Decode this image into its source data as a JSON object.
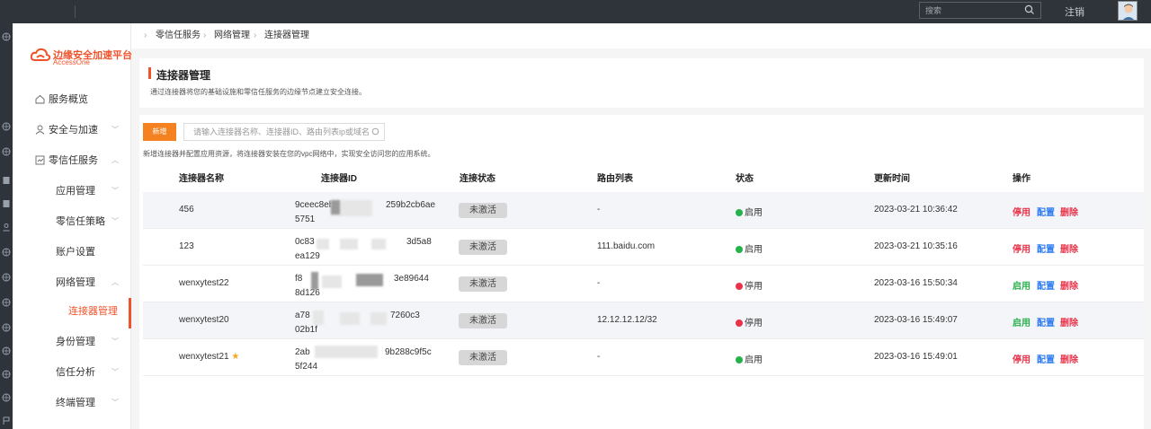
{
  "topbar": {
    "search_placeholder": "搜索",
    "logout": "注销"
  },
  "brand": {
    "title": "边缘安全加速平台",
    "subtitle": "AccessOne",
    "color": "#f0532b"
  },
  "sidebar": {
    "items": [
      {
        "label": "服务概览",
        "icon": "home-icon"
      },
      {
        "label": "安全与加速",
        "icon": "user-icon"
      },
      {
        "label": "零信任服务",
        "icon": "zero-trust-icon"
      }
    ],
    "sub_items": [
      {
        "label": "应用管理"
      },
      {
        "label": "零信任策略"
      },
      {
        "label": "账户设置"
      },
      {
        "label": "网络管理"
      },
      {
        "label": "连接器管理"
      },
      {
        "label": "身份管理"
      },
      {
        "label": "信任分析"
      },
      {
        "label": "终端管理"
      }
    ]
  },
  "breadcrumb": [
    "零信任服务",
    "网络管理",
    "连接器管理"
  ],
  "page": {
    "title": "连接器管理",
    "description": "通过连接器将您的基础设施和零信任服务的边缘节点建立安全连接。"
  },
  "toolbar": {
    "new_label": "新增",
    "filter_placeholder": "请输入连接器名称、连接器ID、路由列表ip或域名",
    "tip": "新增连接器并配置应用资源，将连接器安装在您的vpc网络中，实现安全访问您的应用系统。"
  },
  "table": {
    "headers": [
      "连接器名称",
      "连接器ID",
      "连接状态",
      "路由列表",
      "状态",
      "更新时间",
      "操作"
    ],
    "rows": [
      {
        "name": "456",
        "id_line1": "9ceec8eb",
        "id_line1_tail": "259b2cb6ae",
        "id_line2": "5751",
        "conn": "未激活",
        "route": "-",
        "status": "启用",
        "status_color": "#26b24b",
        "time": "2023-03-21 10:36:42",
        "op1": "停用",
        "op2": "配置",
        "op3": "删除",
        "starred": false
      },
      {
        "name": "123",
        "id_line1": "0c83",
        "id_line1_tail": "3d5a8",
        "id_line2": "ea129",
        "conn": "未激活",
        "route": "111.baidu.com",
        "status": "启用",
        "status_color": "#26b24b",
        "time": "2023-03-21 10:35:16",
        "op1": "停用",
        "op2": "配置",
        "op3": "删除",
        "starred": false
      },
      {
        "name": "wenxytest22",
        "id_line1": "f8",
        "id_line1_tail": "3e89644",
        "id_line2": "8d126",
        "conn": "未激活",
        "route": "-",
        "status": "停用",
        "status_color": "#e8334a",
        "time": "2023-03-16 15:50:34",
        "op1": "启用",
        "op2": "配置",
        "op3": "删除",
        "starred": false
      },
      {
        "name": "wenxytest20",
        "id_line1": "a78",
        "id_line1_tail": "7260c3",
        "id_line2": "02b1f",
        "conn": "未激活",
        "route": "12.12.12.12/32",
        "status": "停用",
        "status_color": "#e8334a",
        "time": "2023-03-16 15:49:07",
        "op1": "启用",
        "op2": "配置",
        "op3": "删除",
        "starred": false
      },
      {
        "name": "wenxytest21",
        "id_line1": "2ab",
        "id_line1_tail": "9b288c9f5c",
        "id_line2": "5f244",
        "conn": "未激活",
        "route": "-",
        "status": "启用",
        "status_color": "#26b24b",
        "time": "2023-03-16 15:49:01",
        "op1": "停用",
        "op2": "配置",
        "op3": "删除",
        "starred": true
      }
    ]
  }
}
